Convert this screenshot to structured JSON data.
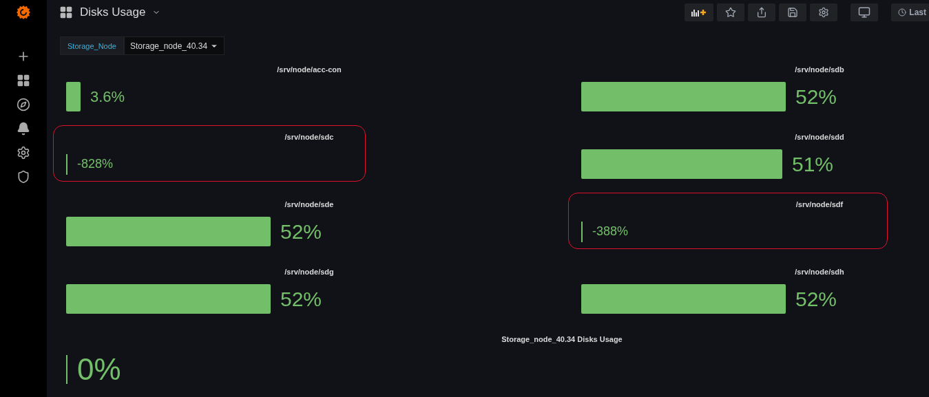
{
  "header": {
    "title": "Disks Usage",
    "time_picker": "Last"
  },
  "variable": {
    "label": "Storage_Node",
    "value": "Storage_node_40.34"
  },
  "panels": [
    {
      "kind": "bar-gauge",
      "title": "/srv/node/acc-con",
      "value": "3.6%",
      "highlighted": false
    },
    {
      "kind": "bar-gauge",
      "title": "/srv/node/sdb",
      "value": "52%",
      "highlighted": false
    },
    {
      "kind": "bar-gauge",
      "title": "/srv/node/sdc",
      "value": "-828%",
      "highlighted": true
    },
    {
      "kind": "bar-gauge",
      "title": "/srv/node/sdd",
      "value": "51%",
      "highlighted": false
    },
    {
      "kind": "bar-gauge",
      "title": "/srv/node/sde",
      "value": "52%",
      "highlighted": false
    },
    {
      "kind": "bar-gauge",
      "title": "/srv/node/sdf",
      "value": "-388%",
      "highlighted": true
    },
    {
      "kind": "bar-gauge",
      "title": "/srv/node/sdg",
      "value": "52%",
      "highlighted": false
    },
    {
      "kind": "bar-gauge",
      "title": "/srv/node/sdh",
      "value": "52%",
      "highlighted": false
    },
    {
      "kind": "stat",
      "title": "Storage_node_40.34 Disks Usage",
      "value": "0%",
      "highlighted": false
    }
  ]
}
